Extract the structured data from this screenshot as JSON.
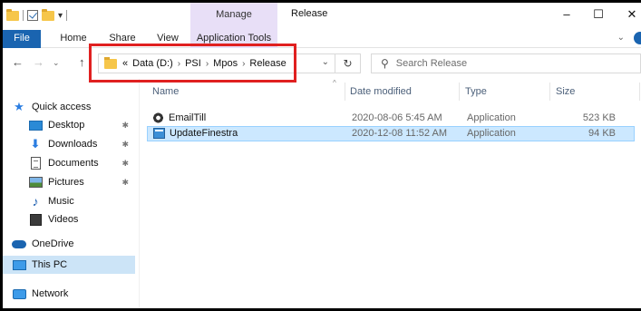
{
  "window": {
    "title": "Release",
    "context_tab": "Manage",
    "controls": {
      "minimize": "–",
      "maximize": "☐",
      "close": "✕"
    }
  },
  "quick_access_toolbar": {
    "dropdown": "▾"
  },
  "ribbon": {
    "tabs": [
      "File",
      "Home",
      "Share",
      "View",
      "Application Tools"
    ],
    "collapse_chevron": "⌄"
  },
  "address_bar": {
    "back": "←",
    "forward": "→",
    "recent_dropdown": "⌄",
    "up": "↑",
    "overflow": "«",
    "breadcrumbs": [
      "Data (D:)",
      "PSI",
      "Mpos",
      "Release"
    ],
    "separator": "›",
    "dropdown": "⌄",
    "refresh": "↻",
    "search_placeholder": "Search Release",
    "search_icon": "⚲"
  },
  "nav_pane": {
    "items": [
      {
        "label": "Quick access",
        "icon": "star-icon",
        "pinned": false
      },
      {
        "label": "Desktop",
        "icon": "desktop-icon",
        "pinned": true
      },
      {
        "label": "Downloads",
        "icon": "download-icon",
        "pinned": true
      },
      {
        "label": "Documents",
        "icon": "document-icon",
        "pinned": true
      },
      {
        "label": "Pictures",
        "icon": "pictures-icon",
        "pinned": true
      },
      {
        "label": "Music",
        "icon": "music-icon",
        "pinned": false
      },
      {
        "label": "Videos",
        "icon": "videos-icon",
        "pinned": false
      },
      {
        "label": "OneDrive",
        "icon": "cloud-icon",
        "pinned": false
      },
      {
        "label": "This PC",
        "icon": "computer-icon",
        "pinned": false,
        "selected": true
      },
      {
        "label": "Network",
        "icon": "network-icon",
        "pinned": false
      }
    ],
    "pin_glyph": "✱"
  },
  "file_list": {
    "columns": {
      "name": "Name",
      "date": "Date modified",
      "type": "Type",
      "size": "Size"
    },
    "sort_indicator": "^",
    "rows": [
      {
        "name": "EmailTill",
        "date": "2020-08-06 5:45 AM",
        "type": "Application",
        "size": "523 KB",
        "icon": "app-gear-icon",
        "selected": false
      },
      {
        "name": "UpdateFinestra",
        "date": "2020-12-08 11:52 AM",
        "type": "Application",
        "size": "94 KB",
        "icon": "app-window-icon",
        "selected": true
      }
    ]
  },
  "annotation": {
    "highlight_color": "#e02020"
  }
}
